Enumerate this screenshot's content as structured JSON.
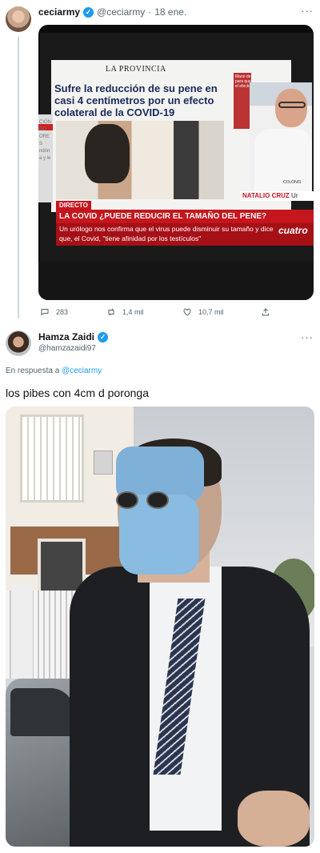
{
  "tweet1": {
    "display_name": "ceciarmy",
    "handle": "@ceciarmy",
    "separator": "·",
    "date": "18 ene.",
    "more": "···",
    "image": {
      "masthead": "LA PROVINCIA",
      "headline": "Sufre la reducción de su pene en casi 4 centímetros por un efecto colateral de la COVID-19",
      "side_text": "Mano de para que el efecto",
      "left_strip": "CIÓN DO ORES ndón a y le",
      "guest_logo": "COLONIS",
      "guest_label": "NATALIO CRUZ",
      "guest_label_suffix": "Ur",
      "live_tag": "DIRECTO",
      "ticker": "LA COVID ¿PUEDE REDUCIR EL TAMAÑO DEL PENE?",
      "subtitle": "Un urólogo nos confirma que el virus puede disminuir su tamaño y dice que, el Covid, \"tiene afinidad por los testículos\"",
      "channel": "cuatro"
    },
    "actions": {
      "replies": "283",
      "retweets": "1,4 mil",
      "likes": "10,7 mil"
    }
  },
  "tweet2": {
    "display_name": "Hamza Zaidi",
    "handle": "@hamzazaidi97",
    "more": "···",
    "reply_prefix": "En respuesta a",
    "reply_to": "@ceciarmy",
    "text": "los pibes con 4cm d poronga"
  },
  "colors": {
    "accent": "#1d9bf0",
    "muted": "#536471",
    "news_red": "#c5161d"
  },
  "icons": [
    "verified-badge-icon",
    "reply-icon",
    "retweet-icon",
    "like-icon",
    "share-icon",
    "more-icon"
  ]
}
